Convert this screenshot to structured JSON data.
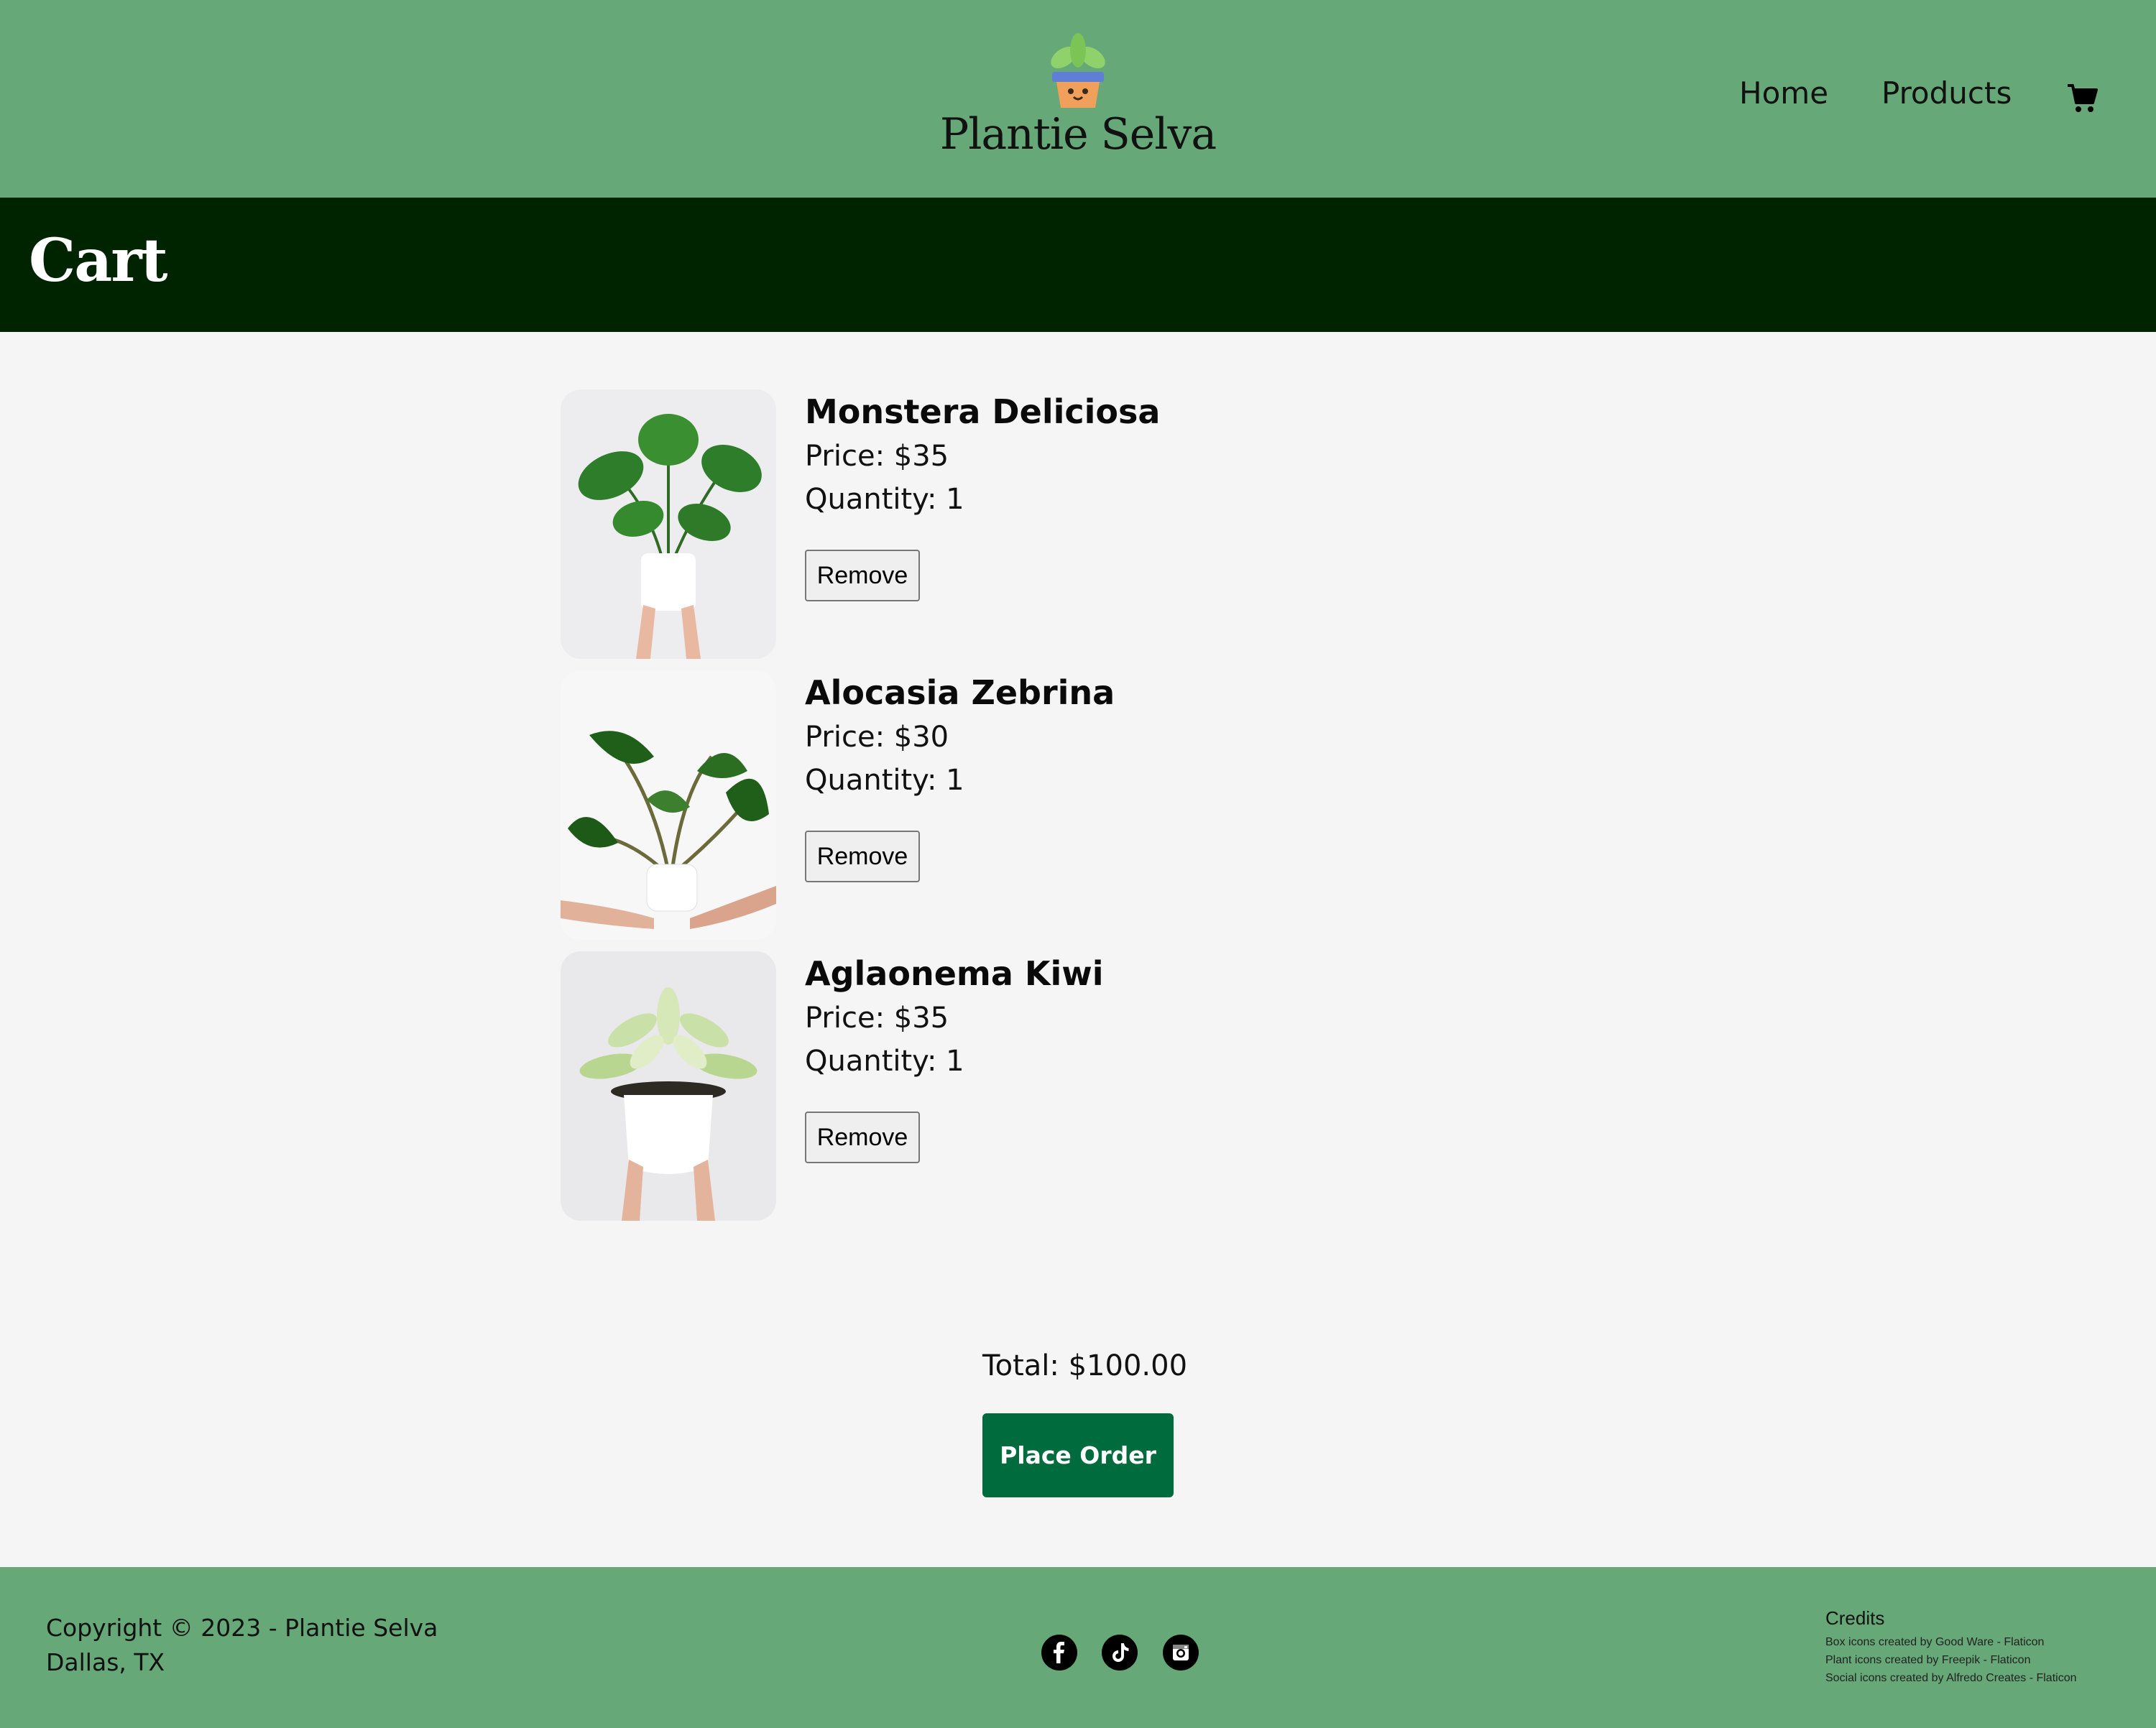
{
  "header": {
    "brand_name": "Plantie Selva",
    "logo_icon": "potted-plant-logo",
    "nav": [
      {
        "label": "Home"
      },
      {
        "label": "Products"
      }
    ],
    "cart_icon": "shopping-cart-icon"
  },
  "page": {
    "title": "Cart"
  },
  "cart": {
    "items": [
      {
        "name": "Monstera Deliciosa",
        "price": "Price: $35",
        "quantity": "Quantity: 1",
        "remove_label": "Remove",
        "image": "monstera-plant-photo"
      },
      {
        "name": "Alocasia Zebrina",
        "price": "Price: $30",
        "quantity": "Quantity: 1",
        "remove_label": "Remove",
        "image": "alocasia-plant-photo"
      },
      {
        "name": "Aglaonema Kiwi",
        "price": "Price: $35",
        "quantity": "Quantity: 1",
        "remove_label": "Remove",
        "image": "aglaonema-plant-photo"
      }
    ],
    "total": "Total: $100.00",
    "place_order_label": "Place Order"
  },
  "footer": {
    "copyright": "Copyright © 2023 - Plantie Selva",
    "location": "Dallas, TX",
    "social": [
      "facebook-icon",
      "tiktok-icon",
      "instagram-icon"
    ],
    "credits_title": "Credits",
    "credits": [
      "Box icons created by Good Ware - Flaticon",
      "Plant icons created by Freepik - Flaticon",
      "Social icons created by Alfredo Creates - Flaticon"
    ]
  },
  "colors": {
    "header_bg": "#66a877",
    "title_band_bg": "#002400",
    "page_bg": "#f5f5f5",
    "place_order_bg": "#006b3c"
  }
}
